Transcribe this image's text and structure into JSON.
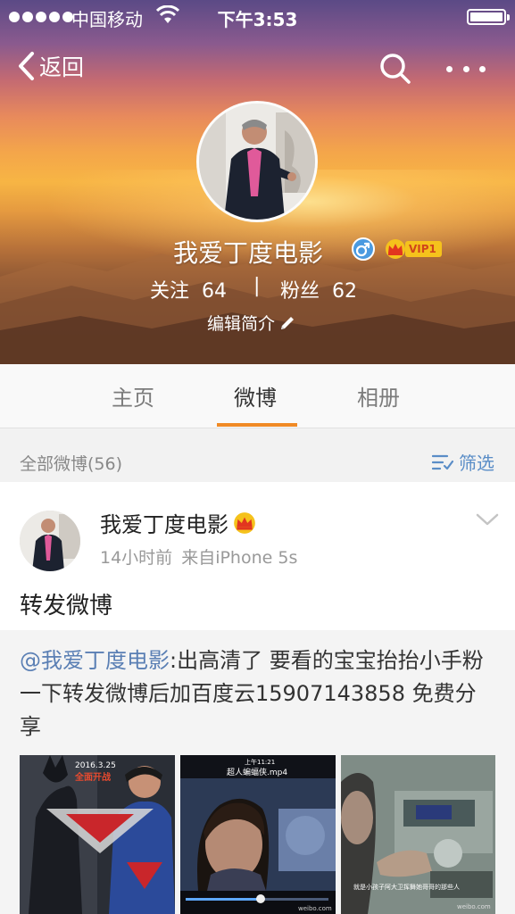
{
  "status_bar": {
    "carrier": "中国移动",
    "time": "下午3:53"
  },
  "nav": {
    "back_label": "返回",
    "search_icon": "search-icon",
    "more_icon": "more-dots-icon"
  },
  "profile": {
    "name": "我爱丁度电影",
    "gender_icon": "male-icon",
    "vip_label": "VIP1",
    "follow_label": "关注",
    "follow_count": "64",
    "separator": "|",
    "fans_label": "粉丝",
    "fans_count": "62",
    "edit_intro_label": "编辑简介"
  },
  "tabs": [
    {
      "label": "主页",
      "active": false
    },
    {
      "label": "微博",
      "active": true
    },
    {
      "label": "相册",
      "active": false
    }
  ],
  "filter": {
    "count_label": "全部微博(56)",
    "filter_label": "筛选"
  },
  "post": {
    "author": "我爱丁度电影",
    "time": "14小时前",
    "source": "来自iPhone 5s",
    "text": "转发微博",
    "retweet": {
      "mention": "@我爱丁度电影",
      "body": ":出高清了 要看的宝宝抬抬小手粉一下转发微博后加百度云15907143858 免费分享"
    },
    "thumbnails": [
      {
        "name": "thumbnail-batman-superman",
        "overlay_text": "2016.3.25 全面开战"
      },
      {
        "name": "thumbnail-video-mp4",
        "top_time": "上午11:21",
        "title": "超人蝙蝠侠.mp4",
        "watermark": "weibo.com"
      },
      {
        "name": "thumbnail-movie-scene",
        "subtitle": "就是小孩子阿大卫挥舞她哥哥的那些人",
        "watermark": "weibo.com"
      }
    ]
  },
  "colors": {
    "accent_orange": "#f08a25",
    "link_blue": "#5a7fb4",
    "vip_gold": "#f5c21c"
  }
}
